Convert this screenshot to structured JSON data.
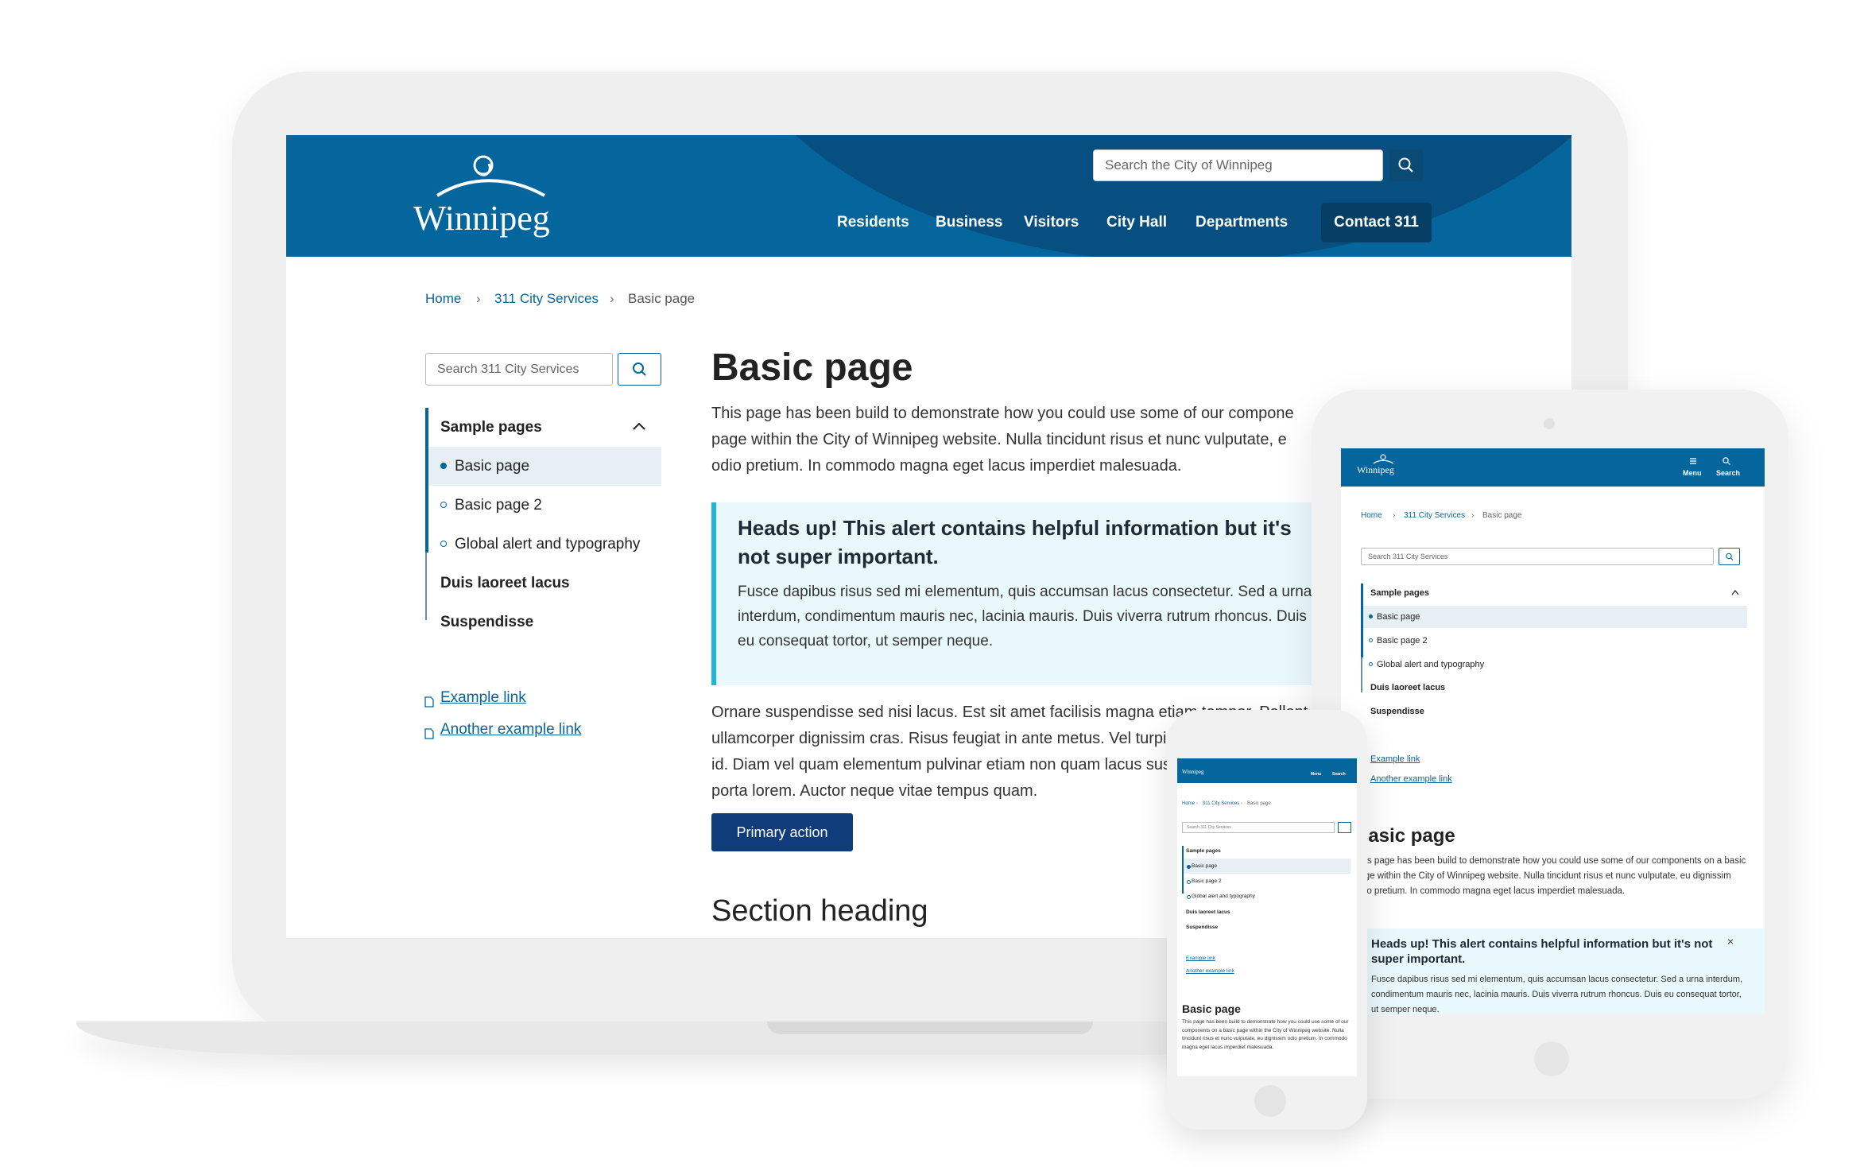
{
  "site": {
    "logo_text": "Winnipeg",
    "header_search_placeholder": "Search the City of Winnipeg",
    "nav": [
      "Residents",
      "Business",
      "Visitors",
      "City Hall",
      "Departments"
    ],
    "contact_label": "Contact 311",
    "breadcrumbs": [
      "Home",
      "311 City Services",
      "Basic page"
    ],
    "sidebar": {
      "search_placeholder": "Search 311 City Services",
      "section_title": "Sample pages",
      "items": [
        "Basic page",
        "Basic page 2",
        "Global alert and typography"
      ],
      "bold_items": [
        "Duis laoreet lacus",
        "Suspendisse"
      ],
      "links": [
        "Example link",
        "Another example link"
      ]
    },
    "main": {
      "title": "Basic page",
      "intro_lines": [
        "This page has been build to demonstrate how you could use some of our compone",
        "page within the City of Winnipeg website. Nulla tincidunt risus et nunc vulputate, e",
        "odio pretium. In commodo magna eget lacus imperdiet malesuada."
      ],
      "alert_title": "Heads up! This alert contains helpful information but it's not super important.",
      "alert_body": "Fusce dapibus risus sed mi elementum, quis accumsan lacus consectetur. Sed a urna interdum, condimentum mauris nec, lacinia mauris. Duis viverra rutrum rhoncus. Duis eu consequat tortor, ut semper neque.",
      "body_lines": [
        "Ornare suspendisse sed nisi lacus. Est sit amet facilisis magna etiam tempor. Pellent",
        "ullamcorper dignissim cras. Risus feugiat in ante metus. Vel turpis nu",
        "id. Diam vel quam elementum pulvinar etiam non quam lacus suspen",
        "porta lorem. Auctor neque vitae tempus quam."
      ],
      "primary_action": "Primary action",
      "section_heading": "Section heading"
    },
    "mobile": {
      "menu_label": "Menu",
      "search_label": "Search",
      "tablet_intro": "This page has been build to demonstrate how you could use some of our components on a basic page within the City of Winnipeg website. Nulla tincidunt risus et nunc vulputate, eu dignissim odio pretium. In commodo magna eget lacus imperdiet malesuada.",
      "tablet_alert_title": "Heads up! This alert contains helpful information but it's not super important.",
      "tablet_alert_body": "Fusce dapibus risus sed mi elementum, quis accumsan lacus consectetur. Sed a urna interdum, condimentum mauris nec, lacinia mauris. Duis viverra rutrum rhoncus. Duis eu consequat tortor, ut semper neque.",
      "close_symbol": "×",
      "phone_intro": "This page has been build to demonstrate how you could use some of our components on a basic page within the City of Winnipeg website. Nulla tincidunt risus et nunc vulputate, eu dignissim odio pretium. In commodo magna eget lacus imperdiet malesuada."
    }
  },
  "colors": {
    "brand_blue": "#05669d",
    "dark_blue": "#063f66",
    "primary_button": "#113c7b",
    "alert_bg": "#e9f8fb",
    "alert_border": "#21b3d8"
  }
}
